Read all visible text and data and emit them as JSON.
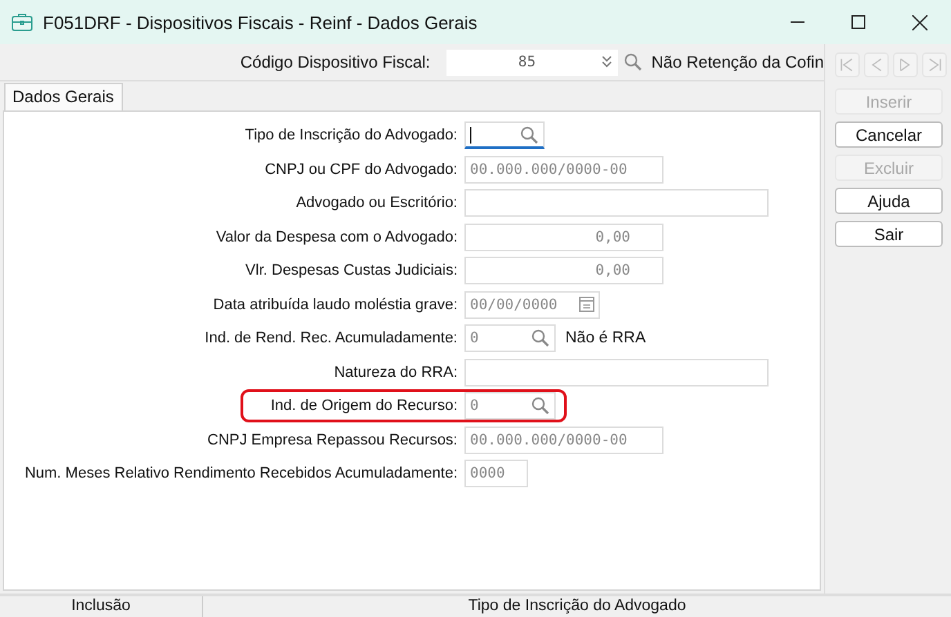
{
  "window": {
    "title": "F051DRF - Dispositivos Fiscais - Reinf - Dados Gerais"
  },
  "header": {
    "label": "Código Dispositivo Fiscal:",
    "value": "85",
    "description": "Não Retenção da Cofin"
  },
  "tabs": [
    {
      "label": "Dados Gerais",
      "selected": true
    }
  ],
  "fields": [
    {
      "label": "Tipo de Inscrição do Advogado:",
      "kind": "lookup",
      "focused": true
    },
    {
      "label": "CNPJ ou CPF do Advogado:",
      "kind": "document",
      "value": "00.000.000/0000-00",
      "focused": false
    },
    {
      "label": "Advogado ou Escritório:",
      "kind": "text",
      "focused": false
    },
    {
      "label": "Valor da Despesa com o Advogado:",
      "kind": "money",
      "value": "0,00",
      "focused": false
    },
    {
      "label": "Vlr. Despesas Custas Judiciais:",
      "kind": "money",
      "value": "0,00",
      "focused": false
    },
    {
      "label": "Data atribuída laudo moléstia grave:",
      "kind": "date",
      "value": "00/00/0000",
      "focused": false
    },
    {
      "label": "Ind. de Rend. Rec. Acumuladamente:",
      "kind": "lookup",
      "value": "0",
      "description": "Não é RRA",
      "focused": false
    },
    {
      "label": "Natureza do RRA:",
      "kind": "text",
      "focused": false
    },
    {
      "label": "Ind. de Origem do Recurso:",
      "kind": "lookup",
      "value": "0",
      "focused": false,
      "highlighted": true
    },
    {
      "label": "CNPJ Empresa Repassou Recursos:",
      "kind": "document",
      "value": "00.000.000/0000-00",
      "focused": false
    },
    {
      "label": "Num. Meses Relativo Rendimento Recebidos Acumuladamente:",
      "kind": "count",
      "value": "0000",
      "focused": false
    }
  ],
  "navigation": [
    {
      "kind": "first",
      "disabled": true
    },
    {
      "kind": "previous",
      "disabled": true
    },
    {
      "kind": "next",
      "disabled": true
    },
    {
      "kind": "last",
      "disabled": true
    }
  ],
  "buttons": [
    {
      "label": "Inserir",
      "disabled": true
    },
    {
      "label": "Cancelar",
      "disabled": false
    },
    {
      "label": "Excluir",
      "disabled": true
    },
    {
      "label": "Ajuda",
      "disabled": false
    },
    {
      "label": "Sair",
      "disabled": false
    }
  ],
  "status_bar": [
    "Inclusão",
    "Tipo de Inscrição do Advogado"
  ]
}
